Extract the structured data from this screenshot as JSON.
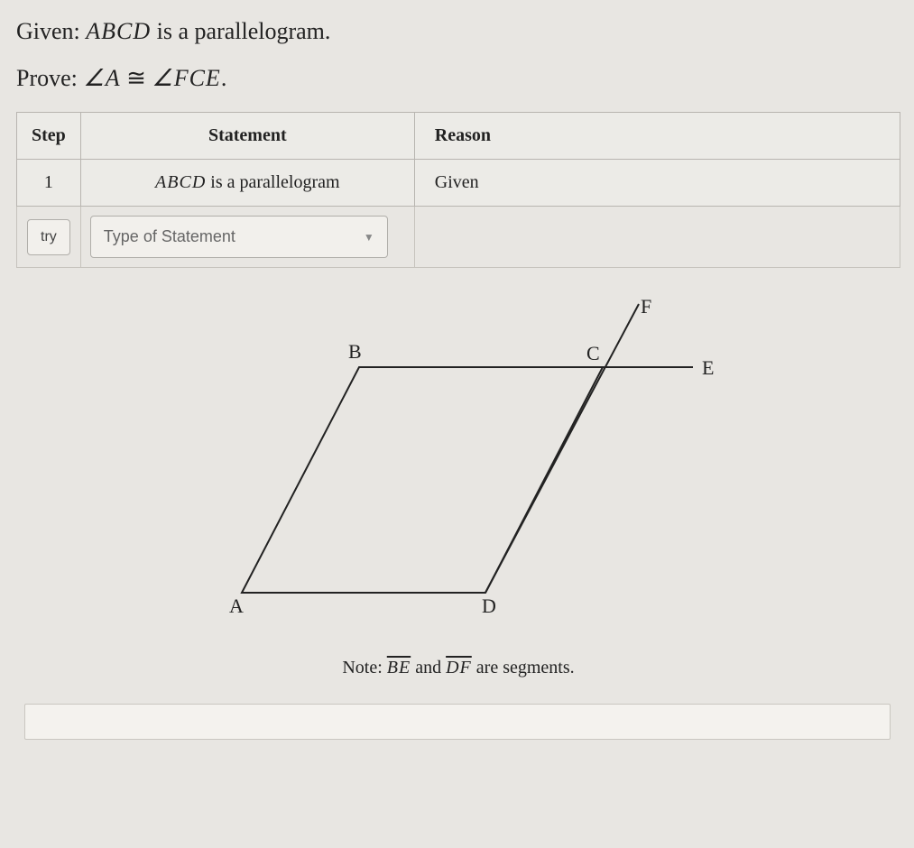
{
  "given": {
    "prefix": "Given: ",
    "math": "ABCD",
    "suffix": " is a parallelogram."
  },
  "prove": {
    "prefix": "Prove: ",
    "lhs": "∠A",
    "rel": " ≅ ",
    "rhs": "∠FCE",
    "suffix": "."
  },
  "table": {
    "headers": {
      "step": "Step",
      "statement": "Statement",
      "reason": "Reason"
    },
    "row1": {
      "step": "1",
      "stmt_math": "ABCD",
      "stmt_suffix": " is a parallelogram",
      "reason": "Given"
    },
    "try_label": "try",
    "type_placeholder": "Type of Statement"
  },
  "figure": {
    "labels": {
      "A": "A",
      "B": "B",
      "C": "C",
      "D": "D",
      "E": "E",
      "F": "F"
    }
  },
  "note": {
    "prefix": "Note: ",
    "seg1": "BE",
    "mid": " and ",
    "seg2": "DF",
    "suffix": " are segments."
  }
}
